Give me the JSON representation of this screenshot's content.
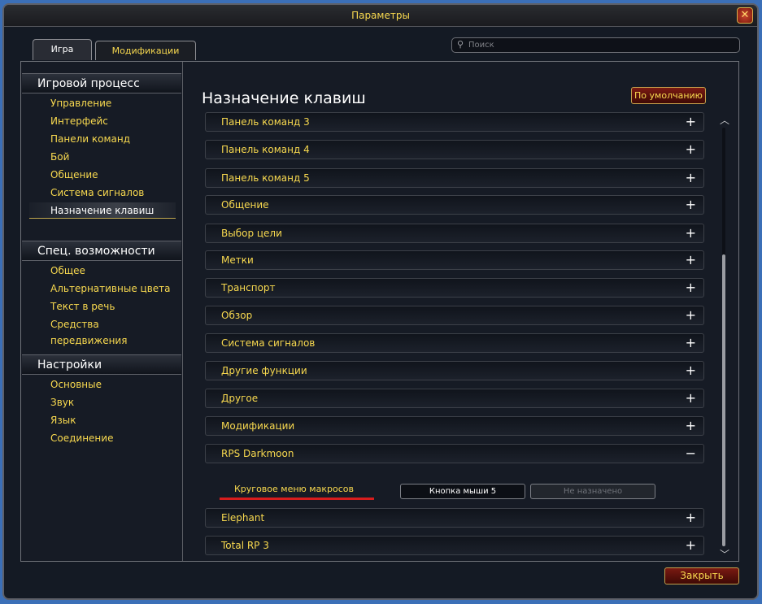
{
  "window": {
    "title": "Параметры",
    "close_glyph": "✕"
  },
  "tabs": [
    {
      "label": "Игра"
    },
    {
      "label": "Модификации"
    }
  ],
  "search": {
    "placeholder": "Поиск",
    "icon": "search-icon",
    "value": ""
  },
  "sidebar": {
    "sections": [
      {
        "title": "Игровой процесс",
        "items": [
          "Управление",
          "Интерфейс",
          "Панели команд",
          "Бой",
          "Общение",
          "Система сигналов",
          "Назначение клавиш"
        ]
      },
      {
        "title": "Спец. возможности",
        "items": [
          "Общее",
          "Альтернативные цвета",
          "Текст в речь",
          "Средства передвижения"
        ]
      },
      {
        "title": "Настройки",
        "items": [
          "Основные",
          "Звук",
          "Язык",
          "Соединение"
        ]
      }
    ],
    "active_item": "Назначение клавиш"
  },
  "content": {
    "title": "Назначение клавиш",
    "default_button": "По умолчанию",
    "categories": [
      {
        "label": "Панель команд 3",
        "expander": "+"
      },
      {
        "label": "Панель команд 4",
        "expander": "+"
      },
      {
        "label": "Панель команд 5",
        "expander": "+"
      },
      {
        "label": "Общение",
        "expander": "+"
      },
      {
        "label": "Выбор цели",
        "expander": "+"
      },
      {
        "label": "Метки",
        "expander": "+"
      },
      {
        "label": "Транспорт",
        "expander": "+"
      },
      {
        "label": "Обзор",
        "expander": "+"
      },
      {
        "label": "Система сигналов",
        "expander": "+"
      },
      {
        "label": "Другие функции",
        "expander": "+"
      },
      {
        "label": "Другое",
        "expander": "+"
      },
      {
        "label": "Модификации",
        "expander": "+"
      },
      {
        "label": "RPS Darkmoon",
        "expander": "−"
      },
      {
        "label": "Elephant",
        "expander": "+"
      },
      {
        "label": "Total RP 3",
        "expander": "+"
      }
    ],
    "binding": {
      "action": "Круговое меню макросов",
      "primary_key": "Кнопка мыши 5",
      "secondary_key": "Не назначено"
    },
    "scroll": {
      "up_glyph": "︿",
      "down_glyph": "﹀",
      "position_fraction": 1.0
    }
  },
  "footer": {
    "close_button": "Закрыть"
  },
  "colors": {
    "gold_text": "#f8d94f",
    "background": "#161b25",
    "accent_red": "#d81d1d"
  }
}
